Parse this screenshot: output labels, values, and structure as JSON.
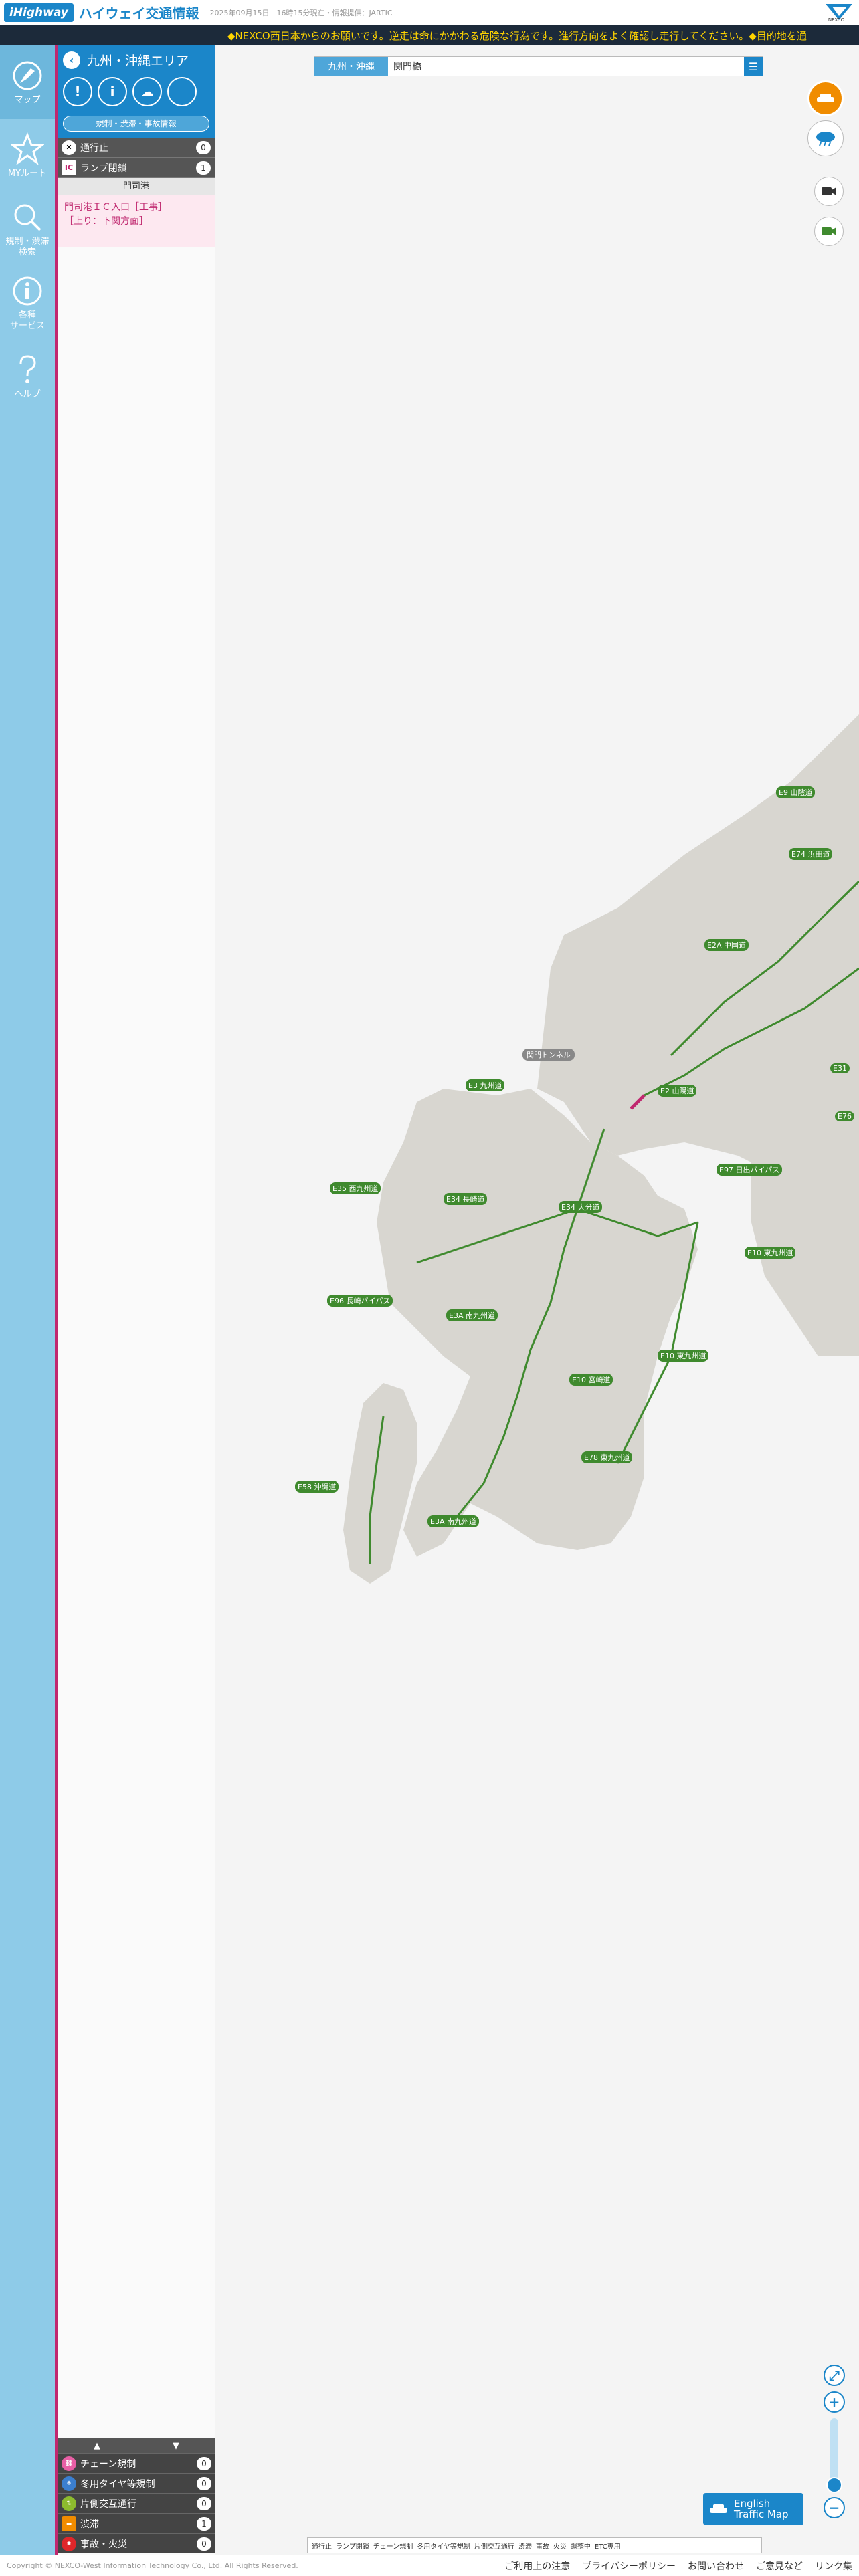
{
  "header": {
    "logo": "iHighway",
    "title": "ハイウェイ交通情報",
    "update_info": "2025年09月15日　16時15分現在・情報提供：JARTIC",
    "brand": "NEXCO"
  },
  "ticker": {
    "text": "◆NEXCO西日本からのお願いです。逆走は命にかかわる危険な行為です。進行方向をよく確認し走行してください。◆目的地を通"
  },
  "nav": {
    "items": [
      {
        "label": "マップ",
        "icon": "compass-icon"
      },
      {
        "label": "MYルート",
        "icon": "star-icon"
      },
      {
        "label": "規制・渋滞\n検索",
        "icon": "search-icon"
      },
      {
        "label": "各種\nサービス",
        "icon": "info-icon"
      },
      {
        "label": "ヘルプ",
        "icon": "help-icon"
      }
    ]
  },
  "panel": {
    "area_title": "九州・沖縄エリア",
    "info_button": "規制・渋滞・事故情報",
    "counts": [
      {
        "label": "通行止",
        "value": "0"
      },
      {
        "label": "ランプ閉鎖",
        "value": "1"
      }
    ],
    "section_title": "門司港",
    "incident_line1": "門司港ＩＣ入口［工事］",
    "incident_line2": "［上り：下関方面］",
    "legend_arrows": [
      "▲",
      "▼"
    ],
    "legend": [
      {
        "label": "チェーン規制",
        "value": "0",
        "color": "#e85fa5",
        "icon": "chain-icon"
      },
      {
        "label": "冬用タイヤ等規制",
        "value": "0",
        "color": "#3b7fd0",
        "icon": "snow-tire-icon"
      },
      {
        "label": "片側交互通行",
        "value": "0",
        "color": "#8dbb2e",
        "icon": "alternate-traffic-icon"
      },
      {
        "label": "渋滞",
        "value": "1",
        "color": "#f08c00",
        "icon": "congestion-icon"
      },
      {
        "label": "事故・火災",
        "value": "0",
        "color": "#e0262a",
        "icon": "accident-icon"
      }
    ]
  },
  "search": {
    "region": "九州・沖縄",
    "value": "関門橋"
  },
  "map_labels": [
    {
      "text": "E9",
      "sub": "山陰道"
    },
    {
      "text": "E74",
      "sub": "浜田道"
    },
    {
      "text": "E2A",
      "sub": "中国道"
    },
    {
      "text": "E31",
      "sub": ""
    },
    {
      "text": "E76",
      "sub": ""
    },
    {
      "text": "E2",
      "sub": "山陽道"
    },
    {
      "text": "E3",
      "sub": "九州道"
    },
    {
      "text": "",
      "sub": "関門トンネル"
    },
    {
      "text": "E97",
      "sub": "日出バイパス"
    },
    {
      "text": "E35",
      "sub": "西九州道"
    },
    {
      "text": "E34",
      "sub": "長崎道"
    },
    {
      "text": "E34",
      "sub": "大分道"
    },
    {
      "text": "E10",
      "sub": "東九州道"
    },
    {
      "text": "E96",
      "sub": "長崎バイパス"
    },
    {
      "text": "E3A",
      "sub": "南九州道"
    },
    {
      "text": "E10",
      "sub": "東九州道"
    },
    {
      "text": "E10",
      "sub": "宮崎道"
    },
    {
      "text": "E58",
      "sub": "沖縄道"
    },
    {
      "text": "E78",
      "sub": "東九州道"
    },
    {
      "text": "E3A",
      "sub": "南九州道"
    }
  ],
  "english_button": {
    "line1": "English",
    "line2": "Traffic Map"
  },
  "map_legend": [
    "通行止",
    "ランプ閉鎖",
    "チェーン規制",
    "冬用タイヤ等規制",
    "片側交互通行",
    "渋滞",
    "事故",
    "火災",
    "調整中",
    "ETC専用"
  ],
  "footer": {
    "copyright": "Copyright © NEXCO-West Information Technology Co., Ltd. All Rights Reserved.",
    "links": [
      "ご利用上の注意",
      "プライバシーポリシー",
      "お問い合わせ",
      "ご意見など",
      "リンク集"
    ]
  },
  "colors": {
    "accent": "#1b86c9",
    "nav_bg": "#8ecbe8",
    "magenta": "#c0286f",
    "road_green": "#3f8a2e"
  }
}
